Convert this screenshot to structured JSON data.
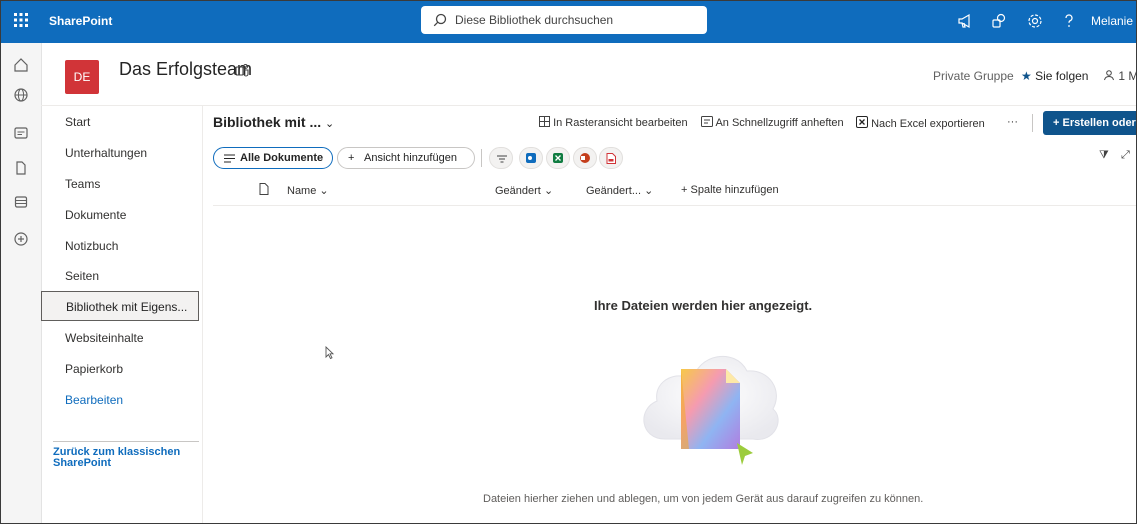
{
  "suite": {
    "brand": "SharePoint",
    "search_placeholder": "Diese Bibliothek durchsuchen",
    "user": "Melanie S"
  },
  "site": {
    "logo_initials": "DE",
    "name": "Das Erfolgsteam",
    "group_type": "Private Gruppe",
    "follow_label": "Sie folgen",
    "members_label": "1 M"
  },
  "nav": {
    "items": [
      "Start",
      "Unterhaltungen",
      "Teams",
      "Dokumente",
      "Notizbuch",
      "Seiten",
      "Bibliothek mit Eigens...",
      "Websiteinhalte",
      "Papierkorb"
    ],
    "edit_label": "Bearbeiten",
    "classic_link": "Zurück zum klassischen SharePoint"
  },
  "library": {
    "title": "Bibliothek mit ...",
    "commands": {
      "grid_edit": "In Rasteransicht bearbeiten",
      "pin_quick": "An Schnellzugriff anheften",
      "export_excel": "Nach Excel exportieren",
      "more": "···",
      "new_button": "+ Erstellen oder"
    },
    "views": {
      "selected": "Alle Dokumente",
      "add_view": "Ansicht hinzufügen"
    },
    "columns": {
      "name": "Name",
      "modified": "Geändert",
      "modified_by": "Geändert...",
      "add_column": "Spalte hinzufügen"
    },
    "empty": {
      "title": "Ihre Dateien werden hier angezeigt.",
      "subtitle": "Dateien hierher ziehen und ablegen, um von jedem Gerät aus darauf zugreifen zu können."
    }
  },
  "colors": {
    "suite_blue": "#0f6cbd",
    "logo_red": "#d13438",
    "primary_button": "#0f548c"
  }
}
